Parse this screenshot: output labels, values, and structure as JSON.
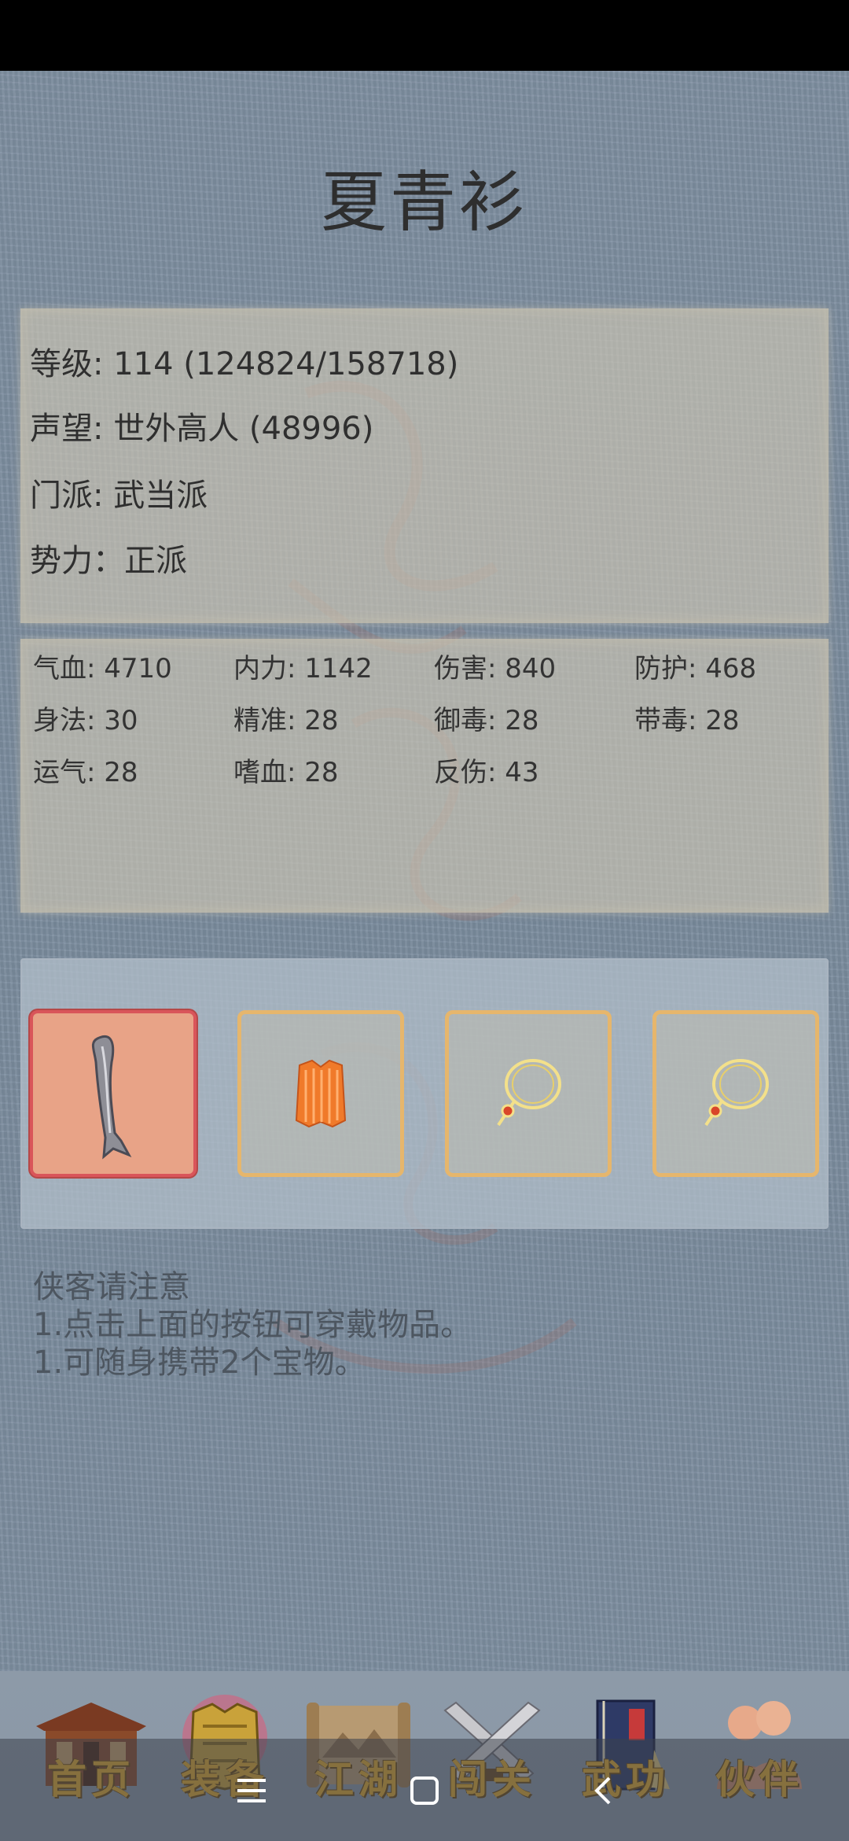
{
  "character": {
    "name": "夏青衫"
  },
  "info": {
    "level": "等级: 114 (124824/158718)",
    "reputation": "声望: 世外高人 (48996)",
    "sect": "门派: 武当派",
    "faction": "势力：正派"
  },
  "stats": [
    "气血: 4710",
    "内力: 1142",
    "伤害: 840",
    "防护: 468",
    "身法: 30",
    "精准: 28",
    "御毒: 28",
    "带毒: 28",
    "运气: 28",
    "嗜血: 28",
    "反伤: 43"
  ],
  "equipment": {
    "slots": [
      {
        "icon": "sword-icon",
        "selected": true
      },
      {
        "icon": "armor-icon",
        "selected": false
      },
      {
        "icon": "necklace-icon",
        "selected": false
      },
      {
        "icon": "necklace-icon",
        "selected": false
      }
    ]
  },
  "notes": {
    "title": "侠客请注意",
    "line1": "1.点击上面的按钮可穿戴物品。",
    "line2": "1.可随身携带2个宝物。"
  },
  "bottom_nav": {
    "items": [
      {
        "label": "首页",
        "icon": "house-icon"
      },
      {
        "label": "装备",
        "icon": "armor-icon"
      },
      {
        "label": "江湖",
        "icon": "scroll-icon"
      },
      {
        "label": "闯关",
        "icon": "crossed-swords-icon"
      },
      {
        "label": "武功",
        "icon": "book-icon"
      },
      {
        "label": "伙伴",
        "icon": "companions-icon"
      }
    ]
  },
  "system_nav": {
    "menu_icon": "menu-icon",
    "home_icon": "home-square-icon",
    "back_icon": "back-chevron-icon"
  },
  "colors": {
    "background": "#7d8ea0",
    "panel": "#d0c8b4",
    "slot_border": "#e6b66c",
    "slot_active_bg": "#e8a387",
    "slot_active_border": "#d9555a",
    "nav_label": "#e0a82e"
  }
}
